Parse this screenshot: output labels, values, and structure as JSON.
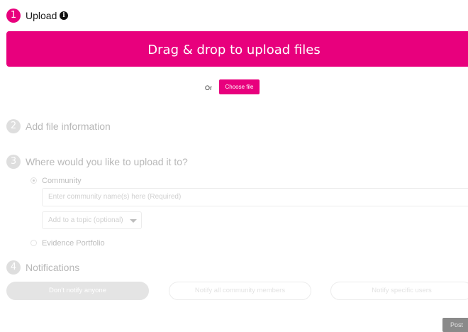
{
  "steps": [
    {
      "number": "1",
      "title": "Upload"
    },
    {
      "number": "2",
      "title": "Add file information"
    },
    {
      "number": "3",
      "title": "Where would you like to upload it to?"
    },
    {
      "number": "4",
      "title": "Notifications"
    }
  ],
  "upload": {
    "dropzone_label": "Drag & drop to upload files",
    "or_label": "Or",
    "choose_file_label": "Choose file"
  },
  "destination": {
    "community_label": "Community",
    "community_selected": true,
    "community_input_placeholder": "Enter community name(s) here (Required)",
    "topic_select_value": "Add to a topic (optional)",
    "evidence_label": "Evidence Portfolio",
    "evidence_selected": false
  },
  "notifications": {
    "options": [
      "Don't notify anyone",
      "Notify all community members",
      "Notify specific users"
    ],
    "selected_index": 0
  },
  "post_label": "Post",
  "colors": {
    "accent": "#e8007d",
    "inactive_step": "#dedede",
    "post_button": "#8a8a8a"
  },
  "icons": {
    "info": "info-icon",
    "dropdown": "chevron-down-icon"
  }
}
